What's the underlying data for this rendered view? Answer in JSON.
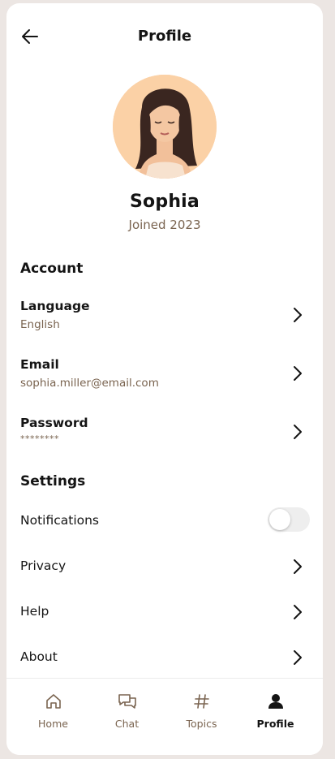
{
  "header": {
    "title": "Profile",
    "back_icon": "arrow-left-icon"
  },
  "profile": {
    "name": "Sophia",
    "joined": "Joined 2023",
    "avatar_bg": "#fbd1a6"
  },
  "account": {
    "title": "Account",
    "items": [
      {
        "label": "Language",
        "value": "English"
      },
      {
        "label": "Email",
        "value": "sophia.miller@email.com"
      },
      {
        "label": "Password",
        "value": "********"
      }
    ]
  },
  "settings": {
    "title": "Settings",
    "notifications": {
      "label": "Notifications",
      "enabled": false
    },
    "items": [
      {
        "label": "Privacy"
      },
      {
        "label": "Help"
      },
      {
        "label": "About"
      }
    ]
  },
  "nav": {
    "items": [
      {
        "label": "Home",
        "icon": "home-icon",
        "active": false
      },
      {
        "label": "Chat",
        "icon": "chat-icon",
        "active": false
      },
      {
        "label": "Topics",
        "icon": "hashtag-icon",
        "active": false
      },
      {
        "label": "Profile",
        "icon": "user-icon",
        "active": true
      }
    ]
  },
  "colors": {
    "accent_text": "#7a6450",
    "background": "#ece6e3",
    "card": "#ffffff"
  }
}
